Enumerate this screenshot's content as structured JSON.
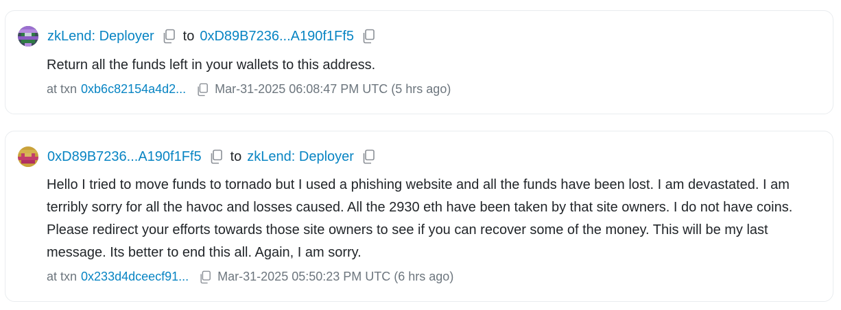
{
  "messages": [
    {
      "from_label": "zkLend: Deployer",
      "to_word": "to",
      "to_label": "0xD89B7236...A190f1Ff5",
      "body": "Return all the funds left in your wallets to this address.",
      "txn_prefix": "at txn",
      "txn_hash": "0xb6c82154a4d2...",
      "timestamp": "Mar-31-2025 06:08:47 PM UTC (5 hrs ago)"
    },
    {
      "from_label": "0xD89B7236...A190f1Ff5",
      "to_word": "to",
      "to_label": "zkLend: Deployer",
      "body": "Hello I tried to move funds to tornado but I used a phishing website and all the funds have been lost. I am devastated. I am terribly sorry for all the havoc and losses caused. All the 2930 eth have been taken by that site owners. I do not have coins. Please redirect your efforts towards those site owners to see if you can recover some of the money. This will be my last message. Its better to end this all. Again, I am sorry.",
      "txn_prefix": "at txn",
      "txn_hash": "0x233d4dceecf91...",
      "timestamp": "Mar-31-2025 05:50:23 PM UTC (6 hrs ago)"
    }
  ],
  "icons": {
    "copy": "copy-icon",
    "avatar1": "deployer-avatar-icon",
    "avatar2": "sender-avatar-icon"
  },
  "colors": {
    "link": "#0784c3",
    "text": "#212529",
    "muted": "#6c757d",
    "border": "#e9ecef"
  }
}
